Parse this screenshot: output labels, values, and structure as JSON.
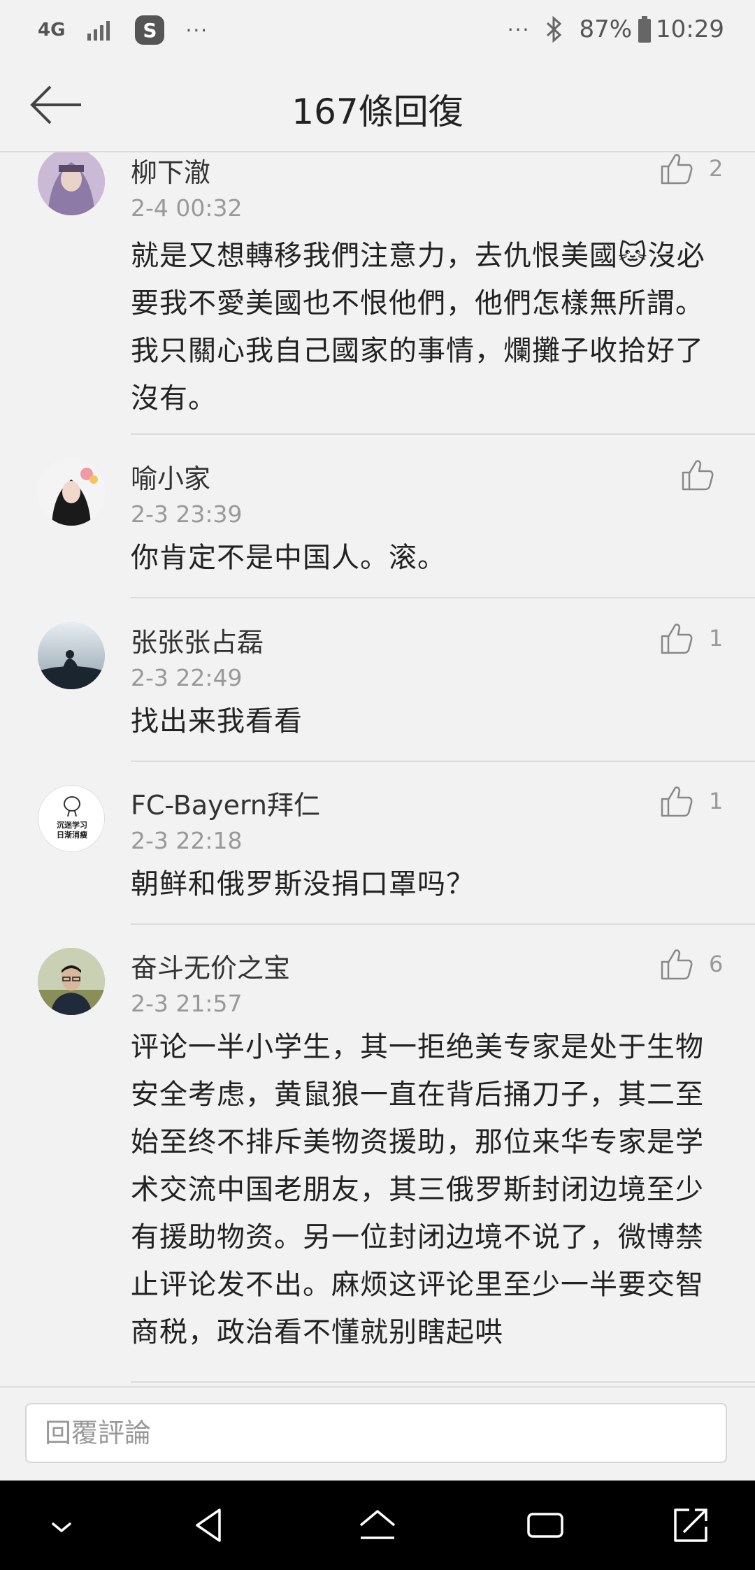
{
  "status_bar": {
    "network": "4G",
    "s_badge": "S",
    "left_dots": "···",
    "right_dots": "···",
    "battery": "87%",
    "time": "10:29"
  },
  "header": {
    "title": "167條回復"
  },
  "comments": [
    {
      "name": "柳下澈",
      "date": "2-4 00:32",
      "likes": "2",
      "text": "就是又想轉移我們注意力，去仇恨美國🐱沒必要我不愛美國也不恨他們，他們怎樣無所謂。我只關心我自己國家的事情，爛攤子收拾好了沒有。"
    },
    {
      "name": "喻小家",
      "date": "2-3 23:39",
      "likes": "",
      "text": "你肯定不是中国人。滚。"
    },
    {
      "name": "张张张占磊",
      "date": "2-3 22:49",
      "likes": "1",
      "text": "找出来我看看"
    },
    {
      "name": "FC-Bayern拜仁",
      "date": "2-3 22:18",
      "likes": "1",
      "text": "朝鲜和俄罗斯没捐口罩吗？",
      "avatar_text_1": "沉迷学习",
      "avatar_text_2": "日渐消瘦"
    },
    {
      "name": "奋斗无价之宝",
      "date": "2-3 21:57",
      "likes": "6",
      "text": "评论一半小学生，其一拒绝美专家是处于生物安全考虑，黄鼠狼一直在背后捅刀子，其二至始至终不排斥美物资援助，那位来华专家是学术交流中国老朋友，其三俄罗斯封闭边境至少有援助物资。另一位封闭边境不说了，微博禁止评论发不出。麻烦这评论里至少一半要交智商税，政治看不懂就别瞎起哄"
    }
  ],
  "reply": {
    "placeholder": "回覆評論"
  },
  "icons": {
    "back": "arrow-left-icon",
    "like": "thumbs-up-icon",
    "bluetooth": "bluetooth-icon",
    "battery": "battery-icon",
    "signal": "signal-icon"
  }
}
